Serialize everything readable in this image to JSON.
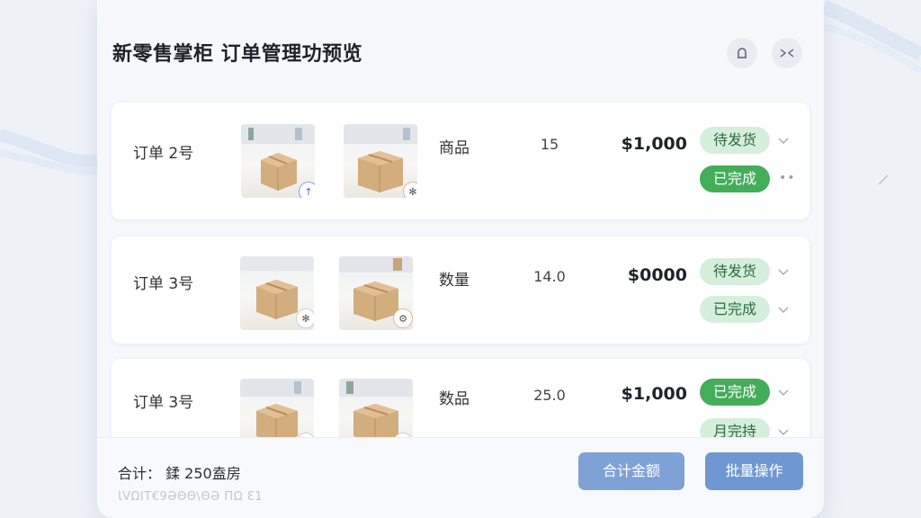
{
  "header": {
    "title": "新零售掌柜 订单管理功预览",
    "user_icon": "person-icon",
    "collapse_icon": "collapse-arrows-icon"
  },
  "orders": [
    {
      "label": "订单 2号",
      "images": [
        {
          "icon": "box-photo",
          "badge_icon": "arrow-up-icon",
          "badge_glyph": "↑"
        },
        {
          "icon": "box-photo",
          "badge_icon": "bug-icon",
          "badge_glyph": "✻"
        }
      ],
      "item": "商品",
      "quantity": "15",
      "price": "$1,000",
      "statuses": [
        {
          "label": "待发货",
          "style": "pending",
          "control": "chevron-down-icon"
        },
        {
          "label": "已完成",
          "style": "done",
          "control": "more-dots-icon"
        }
      ]
    },
    {
      "label": "订单 3号",
      "images": [
        {
          "icon": "box-photo",
          "badge_icon": "bug-icon",
          "badge_glyph": "✻"
        },
        {
          "icon": "box-photo",
          "badge_icon": "tool-icon",
          "badge_glyph": "⚙"
        }
      ],
      "item": "数量",
      "quantity": "14.0",
      "price": "$0000",
      "statuses": [
        {
          "label": "待发货",
          "style": "pending",
          "control": "chevron-down-icon"
        },
        {
          "label": "已完成",
          "style": "done-light",
          "control": "chevron-down-icon"
        }
      ]
    },
    {
      "label": "订单 3号",
      "images": [
        {
          "icon": "box-photo",
          "badge_icon": "arrow-up-icon",
          "badge_glyph": "↑"
        },
        {
          "icon": "box-photo",
          "badge_icon": "tool-icon",
          "badge_glyph": "⚙"
        }
      ],
      "item": "数品",
      "quantity": "25.0",
      "price": "$1,000",
      "statuses": [
        {
          "label": "已完成",
          "style": "done",
          "control": "chevron-down-icon"
        },
        {
          "label": "月完持",
          "style": "pending",
          "control": "chevron-down-icon"
        }
      ]
    }
  ],
  "footer": {
    "total_label": "合计： 鍒 250盍房",
    "sub_text": "ƖVΩIT€9ƏΘΘ\\ΘƏ ΠΩ Ɛ1",
    "sum_button": "合计金额",
    "batch_button": "批量操作"
  },
  "colors": {
    "pending_bg": "#d6efdd",
    "done_bg": "#44ad5a",
    "button_blue": "#6f97d2"
  }
}
